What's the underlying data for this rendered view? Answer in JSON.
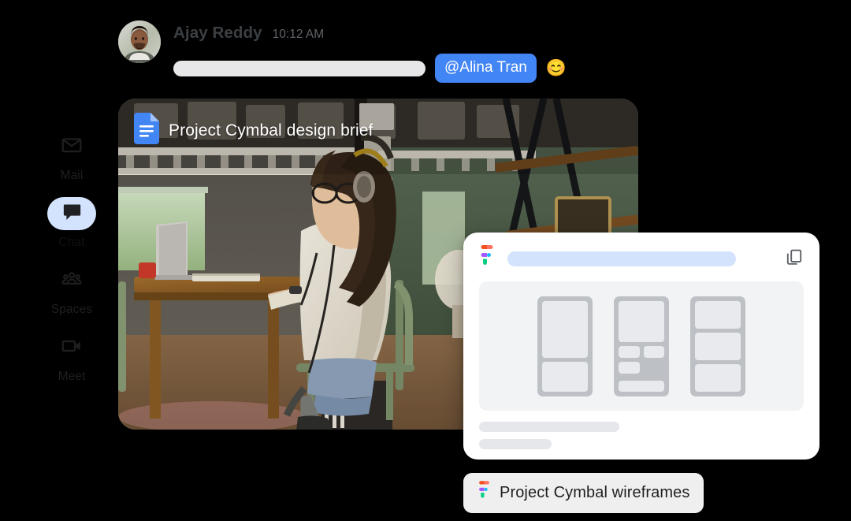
{
  "sidebar": {
    "items": [
      {
        "label": "Mail",
        "icon": "mail-icon",
        "active": false
      },
      {
        "label": "Chat",
        "icon": "chat-icon",
        "active": true
      },
      {
        "label": "Spaces",
        "icon": "spaces-icon",
        "active": false
      },
      {
        "label": "Meet",
        "icon": "meet-icon",
        "active": false
      }
    ]
  },
  "message": {
    "author": "Ajay Reddy",
    "time": "10:12 AM",
    "avatar_alt": "Ajay Reddy profile photo",
    "mention": "@Alina Tran",
    "emoji": "😊",
    "emoji_name": "smiling-face-emoji",
    "placeholder_text": ""
  },
  "photo_card": {
    "doc_icon": "google-docs-icon",
    "doc_title": "Project Cymbal design brief",
    "image_alt": "Woman wearing headphones working on a laptop at a wooden desk in a home office"
  },
  "figma_card": {
    "logo": "figma-logo-icon",
    "title_placeholder": "",
    "copy_icon": "copy-icon",
    "frames": [
      {
        "name": "frame-1",
        "blocks": [
          "large",
          "small"
        ]
      },
      {
        "name": "frame-2",
        "blocks": [
          "large",
          "pair",
          "small",
          "wide"
        ]
      },
      {
        "name": "frame-3",
        "blocks": [
          "equal",
          "equal",
          "equal"
        ]
      }
    ]
  },
  "file_chip": {
    "icon": "figma-logo-icon",
    "label": "Project Cymbal wireframes"
  },
  "colors": {
    "accent_blue": "#4285F4",
    "active_pill": "#D3E3FD",
    "skeleton_gray": "#E7E7EA",
    "canvas_gray": "#F1F3F4",
    "frame_gray": "#BDC1C6",
    "block_gray": "#E8EAED",
    "chip_bg": "#EFEFEF",
    "page_bg": "#000000"
  }
}
